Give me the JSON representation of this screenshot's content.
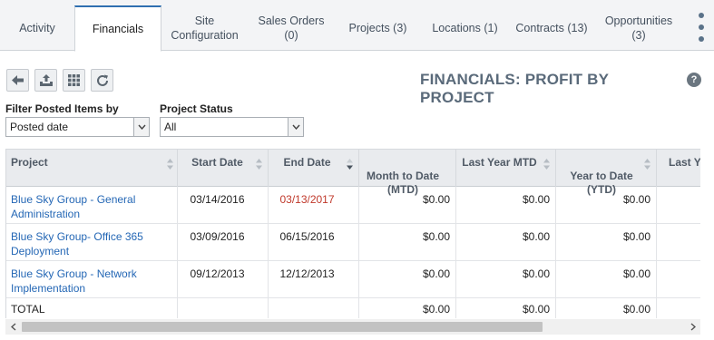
{
  "tabs": [
    {
      "label": "Activity",
      "active": false
    },
    {
      "label": "Financials",
      "active": true
    },
    {
      "label": "Site\nConfiguration",
      "active": false
    },
    {
      "label": "Sales Orders\n(0)",
      "active": false
    },
    {
      "label": "Projects (3)",
      "active": false
    },
    {
      "label": "Locations (1)",
      "active": false
    },
    {
      "label": "Contracts (13)",
      "active": false
    },
    {
      "label": "Opportunities\n(3)",
      "active": false
    }
  ],
  "toolbar": {
    "icons": [
      "back-arrow-icon",
      "export-icon",
      "column-chooser-icon",
      "refresh-icon"
    ]
  },
  "page_title": "FINANCIALS: PROFIT BY PROJECT",
  "help_label": "?",
  "filters": {
    "posted_label": "Filter Posted Items by",
    "posted_value": "Posted date",
    "status_label": "Project Status",
    "status_value": "All"
  },
  "grid": {
    "headers": [
      "Project",
      "Start Date",
      "End Date",
      "Month to Date\n(MTD)",
      "Last Year MTD",
      "Year to Date\n(YTD)",
      "Last Ye"
    ],
    "rows": [
      {
        "project": "Blue Sky Group - General\nAdministration",
        "start": "03/14/2016",
        "end": "03/13/2017",
        "mtd": "$0.00",
        "lymtd": "$0.00",
        "ytd": "$0.00"
      },
      {
        "project": "Blue Sky Group- Office 365\nDeployment",
        "start": "03/09/2016",
        "end": "06/15/2016",
        "mtd": "$0.00",
        "lymtd": "$0.00",
        "ytd": "$0.00"
      },
      {
        "project": "Blue Sky Group - Network\nImplementation",
        "start": "09/12/2013",
        "end": "12/12/2013",
        "mtd": "$0.00",
        "lymtd": "$0.00",
        "ytd": "$0.00"
      }
    ],
    "total": {
      "label": "TOTAL",
      "mtd": "$0.00",
      "lymtd": "$0.00",
      "ytd": "$0.00"
    }
  },
  "colors": {
    "link": "#2467b5",
    "overdue": "#c0392b",
    "tab_accent": "#2f6fb0"
  }
}
